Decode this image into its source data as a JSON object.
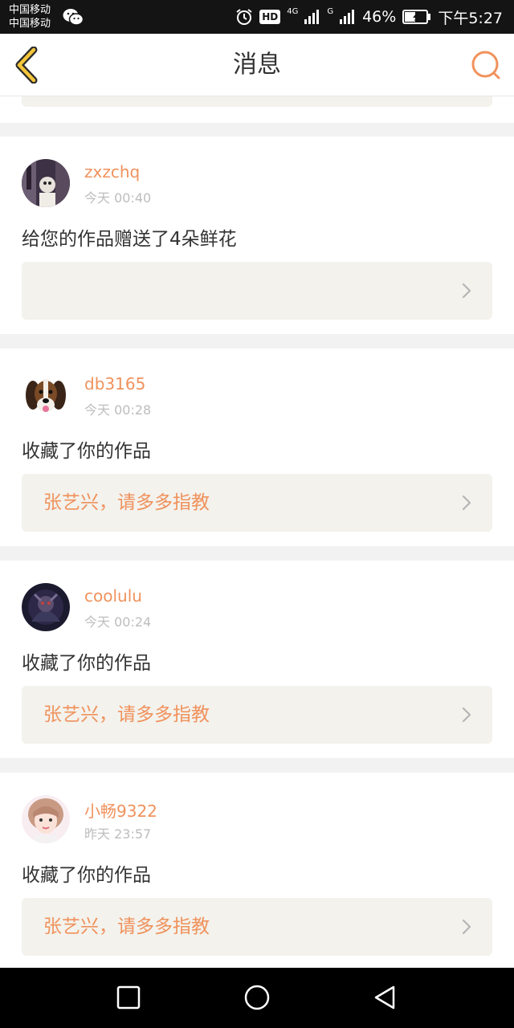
{
  "status_bar": {
    "carrier_1": "中国移动",
    "carrier_2": "中国移动",
    "hd": "HD",
    "network_4g": "4G",
    "network_g": "G",
    "battery": "46%",
    "time": "下午5:27"
  },
  "header": {
    "title": "消息",
    "accent_color": "#f0925c"
  },
  "notifications": [
    {
      "username": "zxzchq",
      "time": "今天 00:40",
      "message": "给您的作品赠送了4朵鲜花",
      "ref": "",
      "avatar_icon": "user-avatar-dark"
    },
    {
      "username": "db3165",
      "time": "今天 00:28",
      "message": "收藏了你的作品",
      "ref": "张艺兴，请多多指教",
      "avatar_icon": "dog-avatar"
    },
    {
      "username": "coolulu",
      "time": "今天 00:24",
      "message": "收藏了你的作品",
      "ref": "张艺兴，请多多指教",
      "avatar_icon": "character-avatar"
    },
    {
      "username": "小畅9322",
      "time": "昨天 23:57",
      "message": "收藏了你的作品",
      "ref": "张艺兴，请多多指教",
      "avatar_icon": "girl-avatar"
    }
  ]
}
